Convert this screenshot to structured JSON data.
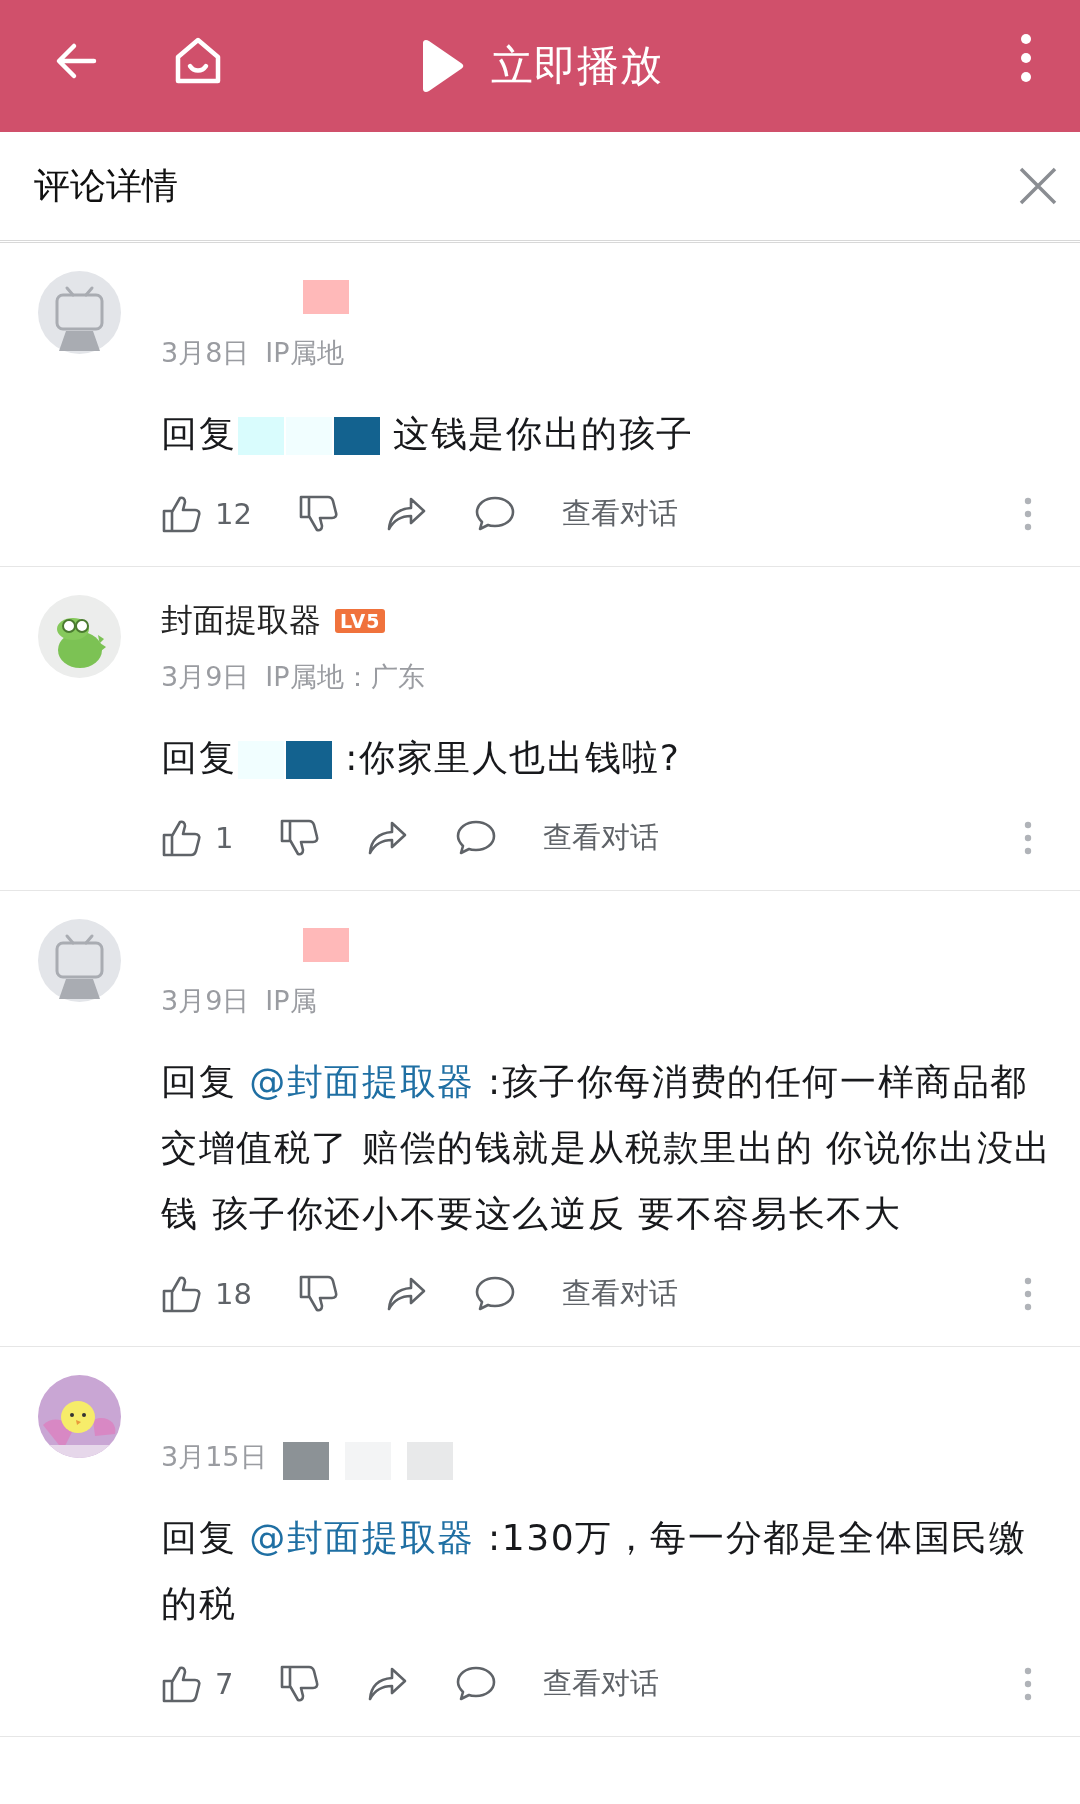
{
  "header": {
    "play_label": "立即播放"
  },
  "panel": {
    "title": "评论详情"
  },
  "comments": [
    {
      "kind": "tv",
      "date": "3月8日",
      "ip": "IP属地",
      "masks": [
        {
          "kind": "name",
          "color": "#ffb9b9"
        },
        {
          "kind": "mention",
          "color": "#d9fcfd"
        },
        {
          "kind": "mention",
          "color": "#f1feff"
        },
        {
          "kind": "mention",
          "color": "#13628f"
        }
      ],
      "reply": "回复",
      "text": "这钱是你出的孩子",
      "likes": "12",
      "action_label": "查看对话"
    },
    {
      "kind": "croc",
      "name": "封面提取器",
      "level": "LV5",
      "date": "3月9日",
      "ip": "IP属地：广东",
      "masks": [
        {
          "kind": "mention",
          "color": "#f1feff"
        },
        {
          "kind": "mention",
          "color": "#13628f"
        }
      ],
      "reply": "回复",
      "text": ":你家里人也出钱啦?",
      "likes": "1",
      "action_label": "查看对话"
    },
    {
      "kind": "tv",
      "date": "3月9日",
      "ip": "IP属",
      "masks": [
        {
          "kind": "name",
          "color": "#ffb9b9"
        }
      ],
      "reply": "回复",
      "mention": "@封面提取器",
      "text": " :孩子你每消费的任何一样商品都交增值税了 赔偿的钱就是从税款里出的 你说你出没出钱 孩子你还小不要这么逆反 要不容易长不大",
      "likes": "18",
      "action_label": "查看对话"
    },
    {
      "kind": "chick",
      "date": "3月15日",
      "masks": [
        {
          "kind": "meta",
          "color": "#8c9296"
        },
        {
          "kind": "meta",
          "color": "#f3f4f5"
        },
        {
          "kind": "meta",
          "color": "#e8e9ea"
        }
      ],
      "reply": "回复",
      "mention": "@封面提取器",
      "text": " :130万，每一分都是全体国民缴的税",
      "likes": "7",
      "action_label": "查看对话"
    }
  ]
}
